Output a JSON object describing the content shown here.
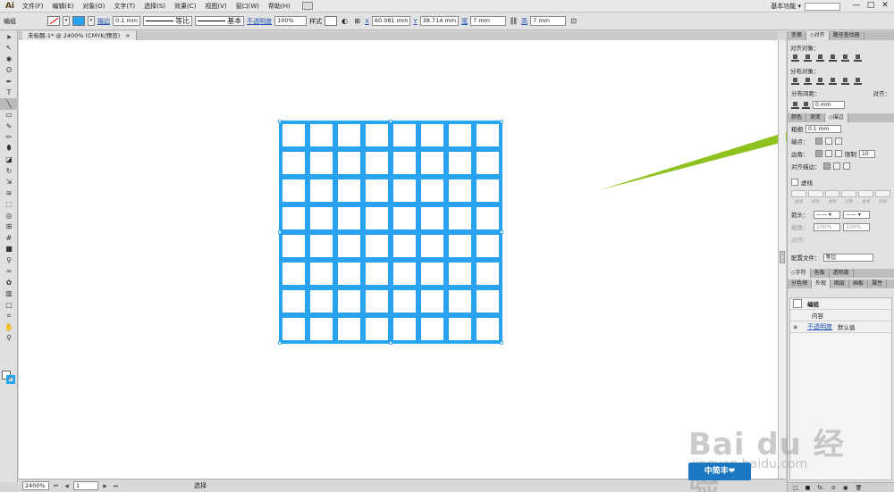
{
  "app": {
    "logo": "Ai"
  },
  "menu": [
    "文件(F)",
    "编辑(E)",
    "对象(O)",
    "文字(T)",
    "选择(S)",
    "效果(C)",
    "视图(V)",
    "窗口(W)",
    "帮助(H)"
  ],
  "workspace": {
    "label": "基本功能 ▾"
  },
  "window_controls": [
    "—",
    "□",
    "✕"
  ],
  "control_bar": {
    "selection": "编组",
    "stroke_label": "描边",
    "stroke_weight": "0.1 mm",
    "profile": "等比",
    "brush": "基本",
    "opacity_label": "不透明度",
    "opacity_value": "100%",
    "style_label": "样式",
    "x_label": "X",
    "x_value": "60.081 mm",
    "y_label": "Y",
    "y_value": "38.714 mm",
    "w_label": "宽",
    "w_value": "7 mm",
    "h_label": "高",
    "h_value": "7 mm"
  },
  "document": {
    "tab_title": "未标题-1* @ 2400% (CMYK/预览)",
    "tab_close": "×",
    "zoom": "2400%",
    "page": "1",
    "status": "选择"
  },
  "tools": [
    "selection-tool",
    "direct-selection-tool",
    "magic-wand-tool",
    "lasso-tool",
    "pen-tool",
    "type-tool",
    "line-segment-tool",
    "rectangle-tool",
    "paintbrush-tool",
    "pencil-tool",
    "blob-brush-tool",
    "eraser-tool",
    "rotate-tool",
    "scale-tool",
    "warp-tool",
    "free-transform-tool",
    "shape-builder-tool",
    "perspective-grid-tool",
    "mesh-tool",
    "gradient-tool",
    "eyedropper-tool",
    "blend-tool",
    "symbol-sprayer-tool",
    "column-graph-tool",
    "artboard-tool",
    "slice-tool",
    "hand-tool",
    "zoom-tool"
  ],
  "tool_glyphs": [
    "➤",
    "↖",
    "✱",
    "ʘ",
    "✒",
    "T",
    "╲",
    "▭",
    "✎",
    "✏",
    "⬮",
    "◪",
    "↻",
    "⇲",
    "≋",
    "⬚",
    "◎",
    "⊞",
    "#",
    "■",
    "⚲",
    "∞",
    "✿",
    "▥",
    "▢",
    "⌗",
    "✋",
    "⚲"
  ],
  "grid": {
    "rows": 8,
    "cols": 8,
    "color": "#29a3f0",
    "stroke_width": 4
  },
  "annotation": {
    "color": "#8dc21f"
  },
  "panels": {
    "align": {
      "tabs": [
        "变换",
        "◇对齐",
        "路径查找器"
      ],
      "align_objects_title": "对齐对象：",
      "distribute_objects_title": "分布对象：",
      "distribute_spacing_title": "分布间距：",
      "align_to_label": "对齐：",
      "spacing_value": "0 mm"
    },
    "stroke": {
      "tabs": [
        "颜色",
        "渐变",
        "◇描边"
      ],
      "weight_label": "粗细",
      "weight_value": "0.1 mm",
      "cap_label": "端点：",
      "corner_label": "边角：",
      "limit_label": "限制",
      "limit_value": "10",
      "align_stroke_label": "对齐描边：",
      "dashed_label": "虚线",
      "dash_labels": [
        "虚线",
        "间隙",
        "虚线",
        "间隙",
        "虚线",
        "间隙"
      ],
      "arrowheads_label": "箭头：",
      "scale_values": [
        "100%",
        "100%"
      ],
      "scale_label": "缩放：",
      "align_label": "对齐：",
      "profile_label": "配置文件：",
      "profile_value": "等比"
    },
    "character": {
      "tabs": [
        "◇字符",
        "色板",
        "透明度"
      ]
    },
    "appearance": {
      "tabs": [
        "分色预",
        "外观",
        "图层",
        "画板",
        "属性"
      ],
      "group_label": "编组",
      "content_label": "内容",
      "opacity_label": "不透明度",
      "opacity_value": "默认值",
      "footer": [
        "□",
        "■",
        "fx.",
        "⊘",
        "▣",
        "🗑"
      ]
    }
  },
  "watermark": {
    "text": "Bai du 经验",
    "url": "jingyan.baidu.com",
    "badge": "中简丰❤"
  }
}
